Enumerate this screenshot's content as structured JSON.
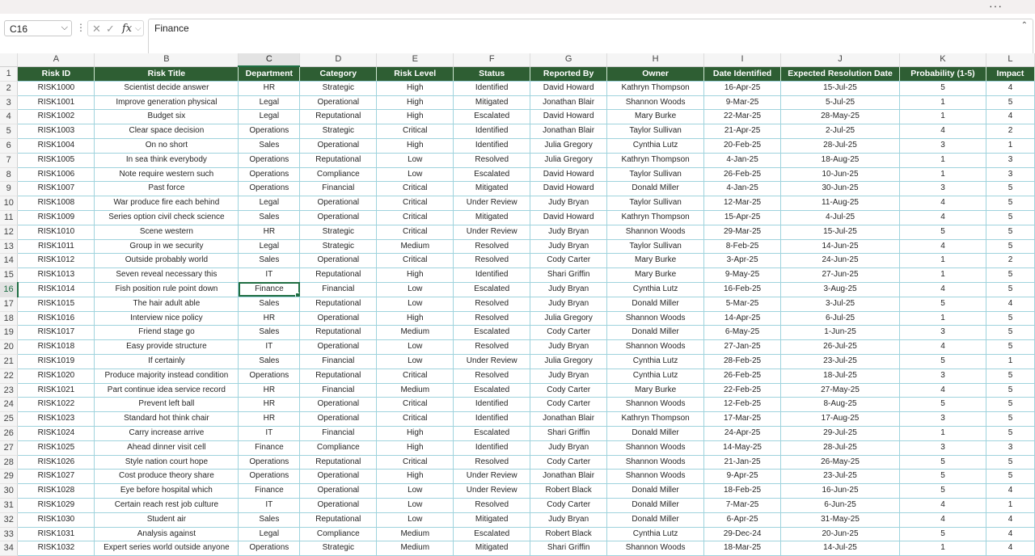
{
  "window": {
    "more_icon": "more-horizontal-icon",
    "more_glyph": "···"
  },
  "formula_bar": {
    "name_box": "C16",
    "content": "Finance",
    "icons": [
      "cancel-icon",
      "enter-icon",
      "function-icon"
    ]
  },
  "grid": {
    "columns": [
      "A",
      "B",
      "C",
      "D",
      "E",
      "F",
      "G",
      "H",
      "I",
      "J",
      "K",
      "L"
    ],
    "selected_column": "C",
    "selected_row": 16,
    "active_cell": "C16",
    "header_fill": "#2e5e33",
    "rows": [
      [
        "Risk ID",
        "Risk Title",
        "Department",
        "Category",
        "Risk Level",
        "Status",
        "Reported By",
        "Owner",
        "Date Identified",
        "Expected Resolution Date",
        "Probability (1-5)",
        "Impact"
      ],
      [
        "RISK1000",
        "Scientist decide answer",
        "HR",
        "Strategic",
        "High",
        "Identified",
        "David Howard",
        "Kathryn Thompson",
        "16-Apr-25",
        "15-Jul-25",
        "5",
        "4"
      ],
      [
        "RISK1001",
        "Improve generation physical",
        "Legal",
        "Operational",
        "High",
        "Mitigated",
        "Jonathan Blair",
        "Shannon Woods",
        "9-Mar-25",
        "5-Jul-25",
        "1",
        "5"
      ],
      [
        "RISK1002",
        "Budget six",
        "Legal",
        "Reputational",
        "High",
        "Escalated",
        "David Howard",
        "Mary Burke",
        "22-Mar-25",
        "28-May-25",
        "1",
        "4"
      ],
      [
        "RISK1003",
        "Clear space decision",
        "Operations",
        "Strategic",
        "Critical",
        "Identified",
        "Jonathan Blair",
        "Taylor Sullivan",
        "21-Apr-25",
        "2-Jul-25",
        "4",
        "2"
      ],
      [
        "RISK1004",
        "On no short",
        "Sales",
        "Operational",
        "High",
        "Identified",
        "Julia Gregory",
        "Cynthia Lutz",
        "20-Feb-25",
        "28-Jul-25",
        "3",
        "1"
      ],
      [
        "RISK1005",
        "In sea think everybody",
        "Operations",
        "Reputational",
        "Low",
        "Resolved",
        "Julia Gregory",
        "Kathryn Thompson",
        "4-Jan-25",
        "18-Aug-25",
        "1",
        "3"
      ],
      [
        "RISK1006",
        "Note require western such",
        "Operations",
        "Compliance",
        "Low",
        "Escalated",
        "David Howard",
        "Taylor Sullivan",
        "26-Feb-25",
        "10-Jun-25",
        "1",
        "3"
      ],
      [
        "RISK1007",
        "Past force",
        "Operations",
        "Financial",
        "Critical",
        "Mitigated",
        "David Howard",
        "Donald Miller",
        "4-Jan-25",
        "30-Jun-25",
        "3",
        "5"
      ],
      [
        "RISK1008",
        "War produce fire each behind",
        "Legal",
        "Operational",
        "Critical",
        "Under Review",
        "Judy Bryan",
        "Taylor Sullivan",
        "12-Mar-25",
        "11-Aug-25",
        "4",
        "5"
      ],
      [
        "RISK1009",
        "Series option civil check science",
        "Sales",
        "Operational",
        "Critical",
        "Mitigated",
        "David Howard",
        "Kathryn Thompson",
        "15-Apr-25",
        "4-Jul-25",
        "4",
        "5"
      ],
      [
        "RISK1010",
        "Scene western",
        "HR",
        "Strategic",
        "Critical",
        "Under Review",
        "Judy Bryan",
        "Shannon Woods",
        "29-Mar-25",
        "15-Jul-25",
        "5",
        "5"
      ],
      [
        "RISK1011",
        "Group in we security",
        "Legal",
        "Strategic",
        "Medium",
        "Resolved",
        "Judy Bryan",
        "Taylor Sullivan",
        "8-Feb-25",
        "14-Jun-25",
        "4",
        "5"
      ],
      [
        "RISK1012",
        "Outside probably world",
        "Sales",
        "Operational",
        "Critical",
        "Resolved",
        "Cody Carter",
        "Mary Burke",
        "3-Apr-25",
        "24-Jun-25",
        "1",
        "2"
      ],
      [
        "RISK1013",
        "Seven reveal necessary this",
        "IT",
        "Reputational",
        "High",
        "Identified",
        "Shari Griffin",
        "Mary Burke",
        "9-May-25",
        "27-Jun-25",
        "1",
        "5"
      ],
      [
        "RISK1014",
        "Fish position rule point down",
        "Finance",
        "Financial",
        "Low",
        "Escalated",
        "Judy Bryan",
        "Cynthia Lutz",
        "16-Feb-25",
        "3-Aug-25",
        "4",
        "5"
      ],
      [
        "RISK1015",
        "The hair adult able",
        "Sales",
        "Reputational",
        "Low",
        "Resolved",
        "Judy Bryan",
        "Donald Miller",
        "5-Mar-25",
        "3-Jul-25",
        "5",
        "4"
      ],
      [
        "RISK1016",
        "Interview nice policy",
        "HR",
        "Operational",
        "High",
        "Resolved",
        "Julia Gregory",
        "Shannon Woods",
        "14-Apr-25",
        "6-Jul-25",
        "1",
        "5"
      ],
      [
        "RISK1017",
        "Friend stage go",
        "Sales",
        "Reputational",
        "Medium",
        "Escalated",
        "Cody Carter",
        "Donald Miller",
        "6-May-25",
        "1-Jun-25",
        "3",
        "5"
      ],
      [
        "RISK1018",
        "Easy provide structure",
        "IT",
        "Operational",
        "Low",
        "Resolved",
        "Judy Bryan",
        "Shannon Woods",
        "27-Jan-25",
        "26-Jul-25",
        "4",
        "5"
      ],
      [
        "RISK1019",
        "If certainly",
        "Sales",
        "Financial",
        "Low",
        "Under Review",
        "Julia Gregory",
        "Cynthia Lutz",
        "28-Feb-25",
        "23-Jul-25",
        "5",
        "1"
      ],
      [
        "RISK1020",
        "Produce majority instead condition",
        "Operations",
        "Reputational",
        "Critical",
        "Resolved",
        "Judy Bryan",
        "Cynthia Lutz",
        "26-Feb-25",
        "18-Jul-25",
        "3",
        "5"
      ],
      [
        "RISK1021",
        "Part continue idea service record",
        "HR",
        "Financial",
        "Medium",
        "Escalated",
        "Cody Carter",
        "Mary Burke",
        "22-Feb-25",
        "27-May-25",
        "4",
        "5"
      ],
      [
        "RISK1022",
        "Prevent left ball",
        "HR",
        "Operational",
        "Critical",
        "Identified",
        "Cody Carter",
        "Shannon Woods",
        "12-Feb-25",
        "8-Aug-25",
        "5",
        "5"
      ],
      [
        "RISK1023",
        "Standard hot think chair",
        "HR",
        "Operational",
        "Critical",
        "Identified",
        "Jonathan Blair",
        "Kathryn Thompson",
        "17-Mar-25",
        "17-Aug-25",
        "3",
        "5"
      ],
      [
        "RISK1024",
        "Carry increase arrive",
        "IT",
        "Financial",
        "High",
        "Escalated",
        "Shari Griffin",
        "Donald Miller",
        "24-Apr-25",
        "29-Jul-25",
        "1",
        "5"
      ],
      [
        "RISK1025",
        "Ahead dinner visit cell",
        "Finance",
        "Compliance",
        "High",
        "Identified",
        "Judy Bryan",
        "Shannon Woods",
        "14-May-25",
        "28-Jul-25",
        "3",
        "3"
      ],
      [
        "RISK1026",
        "Style nation court hope",
        "Operations",
        "Reputational",
        "Critical",
        "Resolved",
        "Cody Carter",
        "Shannon Woods",
        "21-Jan-25",
        "26-May-25",
        "5",
        "5"
      ],
      [
        "RISK1027",
        "Cost produce theory share",
        "Operations",
        "Operational",
        "High",
        "Under Review",
        "Jonathan Blair",
        "Shannon Woods",
        "9-Apr-25",
        "23-Jul-25",
        "5",
        "5"
      ],
      [
        "RISK1028",
        "Eye before hospital which",
        "Finance",
        "Operational",
        "Low",
        "Under Review",
        "Robert Black",
        "Donald Miller",
        "18-Feb-25",
        "16-Jun-25",
        "5",
        "4"
      ],
      [
        "RISK1029",
        "Certain reach rest job culture",
        "IT",
        "Operational",
        "Low",
        "Resolved",
        "Cody Carter",
        "Donald Miller",
        "7-Mar-25",
        "6-Jun-25",
        "4",
        "1"
      ],
      [
        "RISK1030",
        "Student air",
        "Sales",
        "Reputational",
        "Low",
        "Mitigated",
        "Judy Bryan",
        "Donald Miller",
        "6-Apr-25",
        "31-May-25",
        "4",
        "4"
      ],
      [
        "RISK1031",
        "Analysis against",
        "Legal",
        "Compliance",
        "Medium",
        "Escalated",
        "Robert Black",
        "Cynthia Lutz",
        "29-Dec-24",
        "20-Jun-25",
        "5",
        "4"
      ],
      [
        "RISK1032",
        "Expert series world outside anyone",
        "Operations",
        "Strategic",
        "Medium",
        "Mitigated",
        "Shari Griffin",
        "Shannon Woods",
        "18-Mar-25",
        "14-Jul-25",
        "1",
        "4"
      ]
    ]
  }
}
